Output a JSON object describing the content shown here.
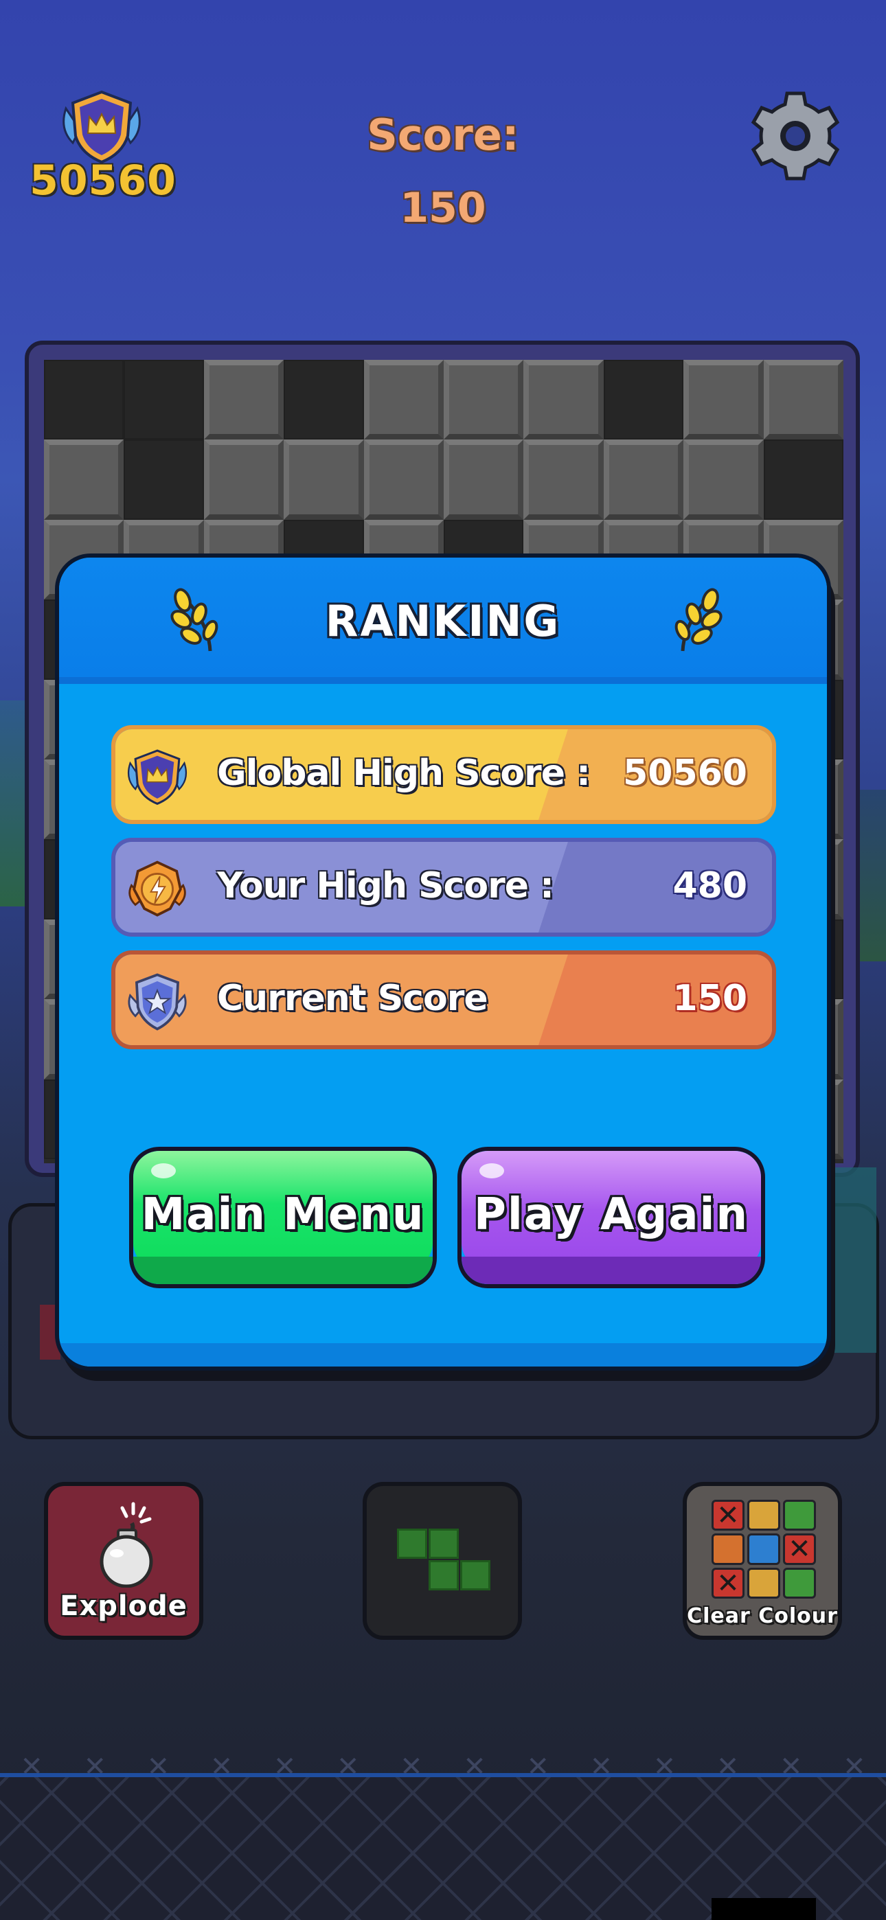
{
  "header": {
    "best_score": "50560",
    "score_label": "Score:",
    "score_value": "150",
    "icons": {
      "rank_badge": "crown-shield-badge-icon",
      "settings": "gear-icon"
    }
  },
  "board": {
    "columns": 10,
    "visible_rows": 3,
    "pattern": [
      [
        0,
        0,
        1,
        0,
        1,
        1,
        1,
        0,
        1,
        1
      ],
      [
        1,
        0,
        1,
        1,
        1,
        1,
        1,
        1,
        1,
        0
      ],
      [
        1,
        1,
        1,
        0,
        1,
        0,
        1,
        1,
        1,
        1
      ]
    ],
    "colors": {
      "filled": "#5c5c5c",
      "empty": "#262626"
    }
  },
  "modal": {
    "title": "RANKING",
    "icons": {
      "left": "laurel-icon",
      "right": "laurel-icon"
    },
    "rows": [
      {
        "label": "Global High Score :",
        "value": "50560",
        "icon": "crown-shield-badge-icon"
      },
      {
        "label": "Your High Score :",
        "value": "480",
        "icon": "lightning-badge-icon"
      },
      {
        "label": "Current Score",
        "value": "150",
        "icon": "star-shield-badge-icon"
      }
    ],
    "buttons": {
      "main_menu": "Main Menu",
      "play_again": "Play Again"
    },
    "colors": {
      "panel": "#049ef2",
      "main_menu": "#19e36a",
      "play_again": "#a656ee"
    }
  },
  "powerups": {
    "explode": {
      "label": "Explode",
      "icon": "bomb-icon"
    },
    "piece": {
      "icon": "s-tetromino-icon"
    },
    "clear_colour": {
      "label": "Clear Colour",
      "icon": "color-grid-icon",
      "cells": [
        {
          "color": "#c9372f",
          "crossed": true
        },
        {
          "color": "#d9a43a",
          "crossed": false
        },
        {
          "color": "#3f9a3b",
          "crossed": false
        },
        {
          "color": "#d4712f",
          "crossed": false
        },
        {
          "color": "#2d7fd0",
          "crossed": false
        },
        {
          "color": "#c9372f",
          "crossed": true
        },
        {
          "color": "#c9372f",
          "crossed": true
        },
        {
          "color": "#d9a43a",
          "crossed": false
        },
        {
          "color": "#3f9a3b",
          "crossed": false
        }
      ]
    }
  }
}
